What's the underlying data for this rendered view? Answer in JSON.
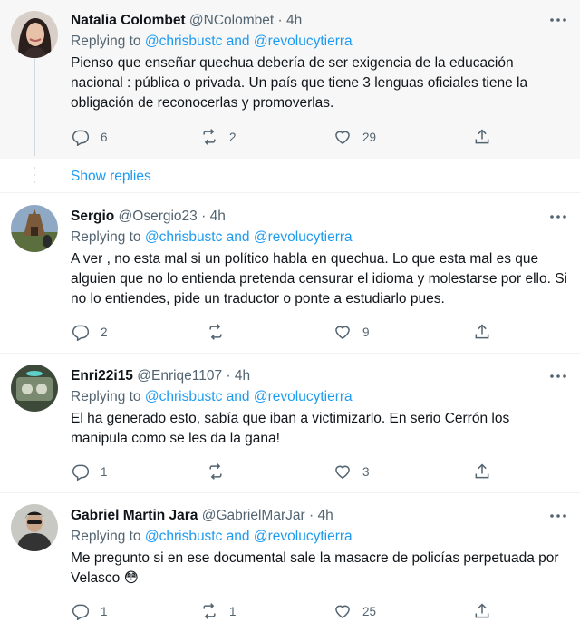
{
  "colors": {
    "accent": "#1d9bf0",
    "secondary_text": "#536471",
    "primary_text": "#0f1419",
    "highlight_bg": "#f7f7f7",
    "divider": "#eff3f4"
  },
  "icons": {
    "more": "more-horizontal-icon",
    "reply": "reply-icon",
    "retweet": "retweet-icon",
    "like": "heart-icon",
    "share": "share-icon"
  },
  "separator": "·",
  "reply_prefix": "Replying to",
  "reply_conjunction": "and",
  "show_replies_label": "Show replies",
  "tweets": [
    {
      "name": "Natalia Colombet",
      "handle": "@NColombet",
      "time": "4h",
      "mentions": [
        "@chrisbustc",
        "@revolucytierra"
      ],
      "text": "Pienso que enseñar quechua debería de ser exigencia de la educación nacional : pública o privada. Un país que tiene 3 lenguas oficiales tiene la obligación de reconocerlas y promoverlas.",
      "replies": "6",
      "retweets": "2",
      "likes": "29"
    },
    {
      "name": "Sergio",
      "handle": "@Osergio23",
      "time": "4h",
      "mentions": [
        "@chrisbustc",
        "@revolucytierra"
      ],
      "text": "A ver , no esta mal si un político habla en quechua. Lo que esta mal es que alguien que no lo entienda pretenda censurar el idioma y molestarse por ello. Si no lo entiendes, pide un traductor o ponte a estudiarlo pues.",
      "replies": "2",
      "retweets": "",
      "likes": "9"
    },
    {
      "name": "Enri22i15",
      "handle": "@Enriqe1107",
      "time": "4h",
      "mentions": [
        "@chrisbustc",
        "@revolucytierra"
      ],
      "text": "El ha generado esto, sabía que iban a victimizarlo. En serio Cerrón los manipula como se les da la gana!",
      "replies": "1",
      "retweets": "",
      "likes": "3"
    },
    {
      "name": "Gabriel Martin Jara",
      "handle": "@GabrielMarJar",
      "time": "4h",
      "mentions": [
        "@chrisbustc",
        "@revolucytierra"
      ],
      "text": "Me pregunto si en ese documental sale la masacre de policías perpetuada por Velasco 😳",
      "replies": "1",
      "retweets": "1",
      "likes": "25"
    }
  ]
}
